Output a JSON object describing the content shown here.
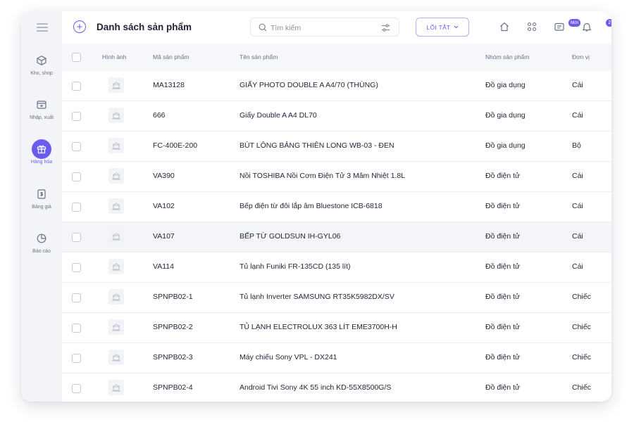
{
  "sidebar": {
    "items": [
      {
        "label": "Kho, shop",
        "icon": "cube-icon"
      },
      {
        "label": "Nhập, xuất",
        "icon": "import-export-icon"
      },
      {
        "label": "Hàng hóa",
        "icon": "goods-box-icon",
        "active": true
      },
      {
        "label": "Bảng giá",
        "icon": "price-list-icon"
      },
      {
        "label": "Báo cáo",
        "icon": "report-chart-icon"
      }
    ]
  },
  "header": {
    "title": "Danh sách sản phẩm",
    "search_placeholder": "Tìm kiếm",
    "shortcut_label": "LỐI TẮT",
    "new_badge": "Mới",
    "notification_count": "2"
  },
  "table": {
    "columns": {
      "image": "Hình ảnh",
      "code": "Mã sản phẩm",
      "name": "Tên sản phẩm",
      "group": "Nhóm sản phẩm",
      "unit": "Đơn vị"
    },
    "rows": [
      {
        "code": "MA13128",
        "name": "GIẤY PHOTO DOUBLE A A4/70 (THÙNG)",
        "group": "Đồ gia dụng",
        "unit": "Cái"
      },
      {
        "code": "666",
        "name": "Giấy Double A A4 DL70",
        "group": "Đồ gia dụng",
        "unit": "Cái"
      },
      {
        "code": "FC-400E-200",
        "name": "BÚT LÔNG BẢNG THIÊN LONG WB-03 - ĐEN",
        "group": "Đồ gia dụng",
        "unit": "Bộ"
      },
      {
        "code": "VA390",
        "name": "Nồi TOSHIBA Nồi Cơm Điện Tử 3 Mâm Nhiệt 1.8L",
        "group": "Đồ điện tử",
        "unit": "Cái"
      },
      {
        "code": "VA102",
        "name": "Bếp điện từ đôi lắp âm Bluestone ICB-6818",
        "group": "Đồ điện tử",
        "unit": "Cái"
      },
      {
        "code": "VA107",
        "name": "BẾP TỪ GOLDSUN IH-GYL06",
        "group": "Đồ điện tử",
        "unit": "Cái"
      },
      {
        "code": "VA114",
        "name": "Tủ lạnh Funiki FR-135CD (135 lít)",
        "group": "Đồ điện tử",
        "unit": "Cái"
      },
      {
        "code": "SPNPB02-1",
        "name": "Tủ lạnh Inverter SAMSUNG RT35K5982DX/SV",
        "group": "Đồ điện tử",
        "unit": "Chiếc"
      },
      {
        "code": "SPNPB02-2",
        "name": "TỦ LẠNH ELECTROLUX 363 LÍT EME3700H-H",
        "group": "Đồ điện tử",
        "unit": "Chiếc"
      },
      {
        "code": "SPNPB02-3",
        "name": "Máy chiếu Sony VPL - DX241",
        "group": "Đồ điện tử",
        "unit": "Chiếc"
      },
      {
        "code": "SPNPB02-4",
        "name": "Android Tivi Sony 4K 55 inch KD-55X8500G/S",
        "group": "Đồ điện tử",
        "unit": "Chiếc"
      }
    ]
  },
  "colors": {
    "accent": "#6b5cf0",
    "brand": "#f25a1f"
  }
}
